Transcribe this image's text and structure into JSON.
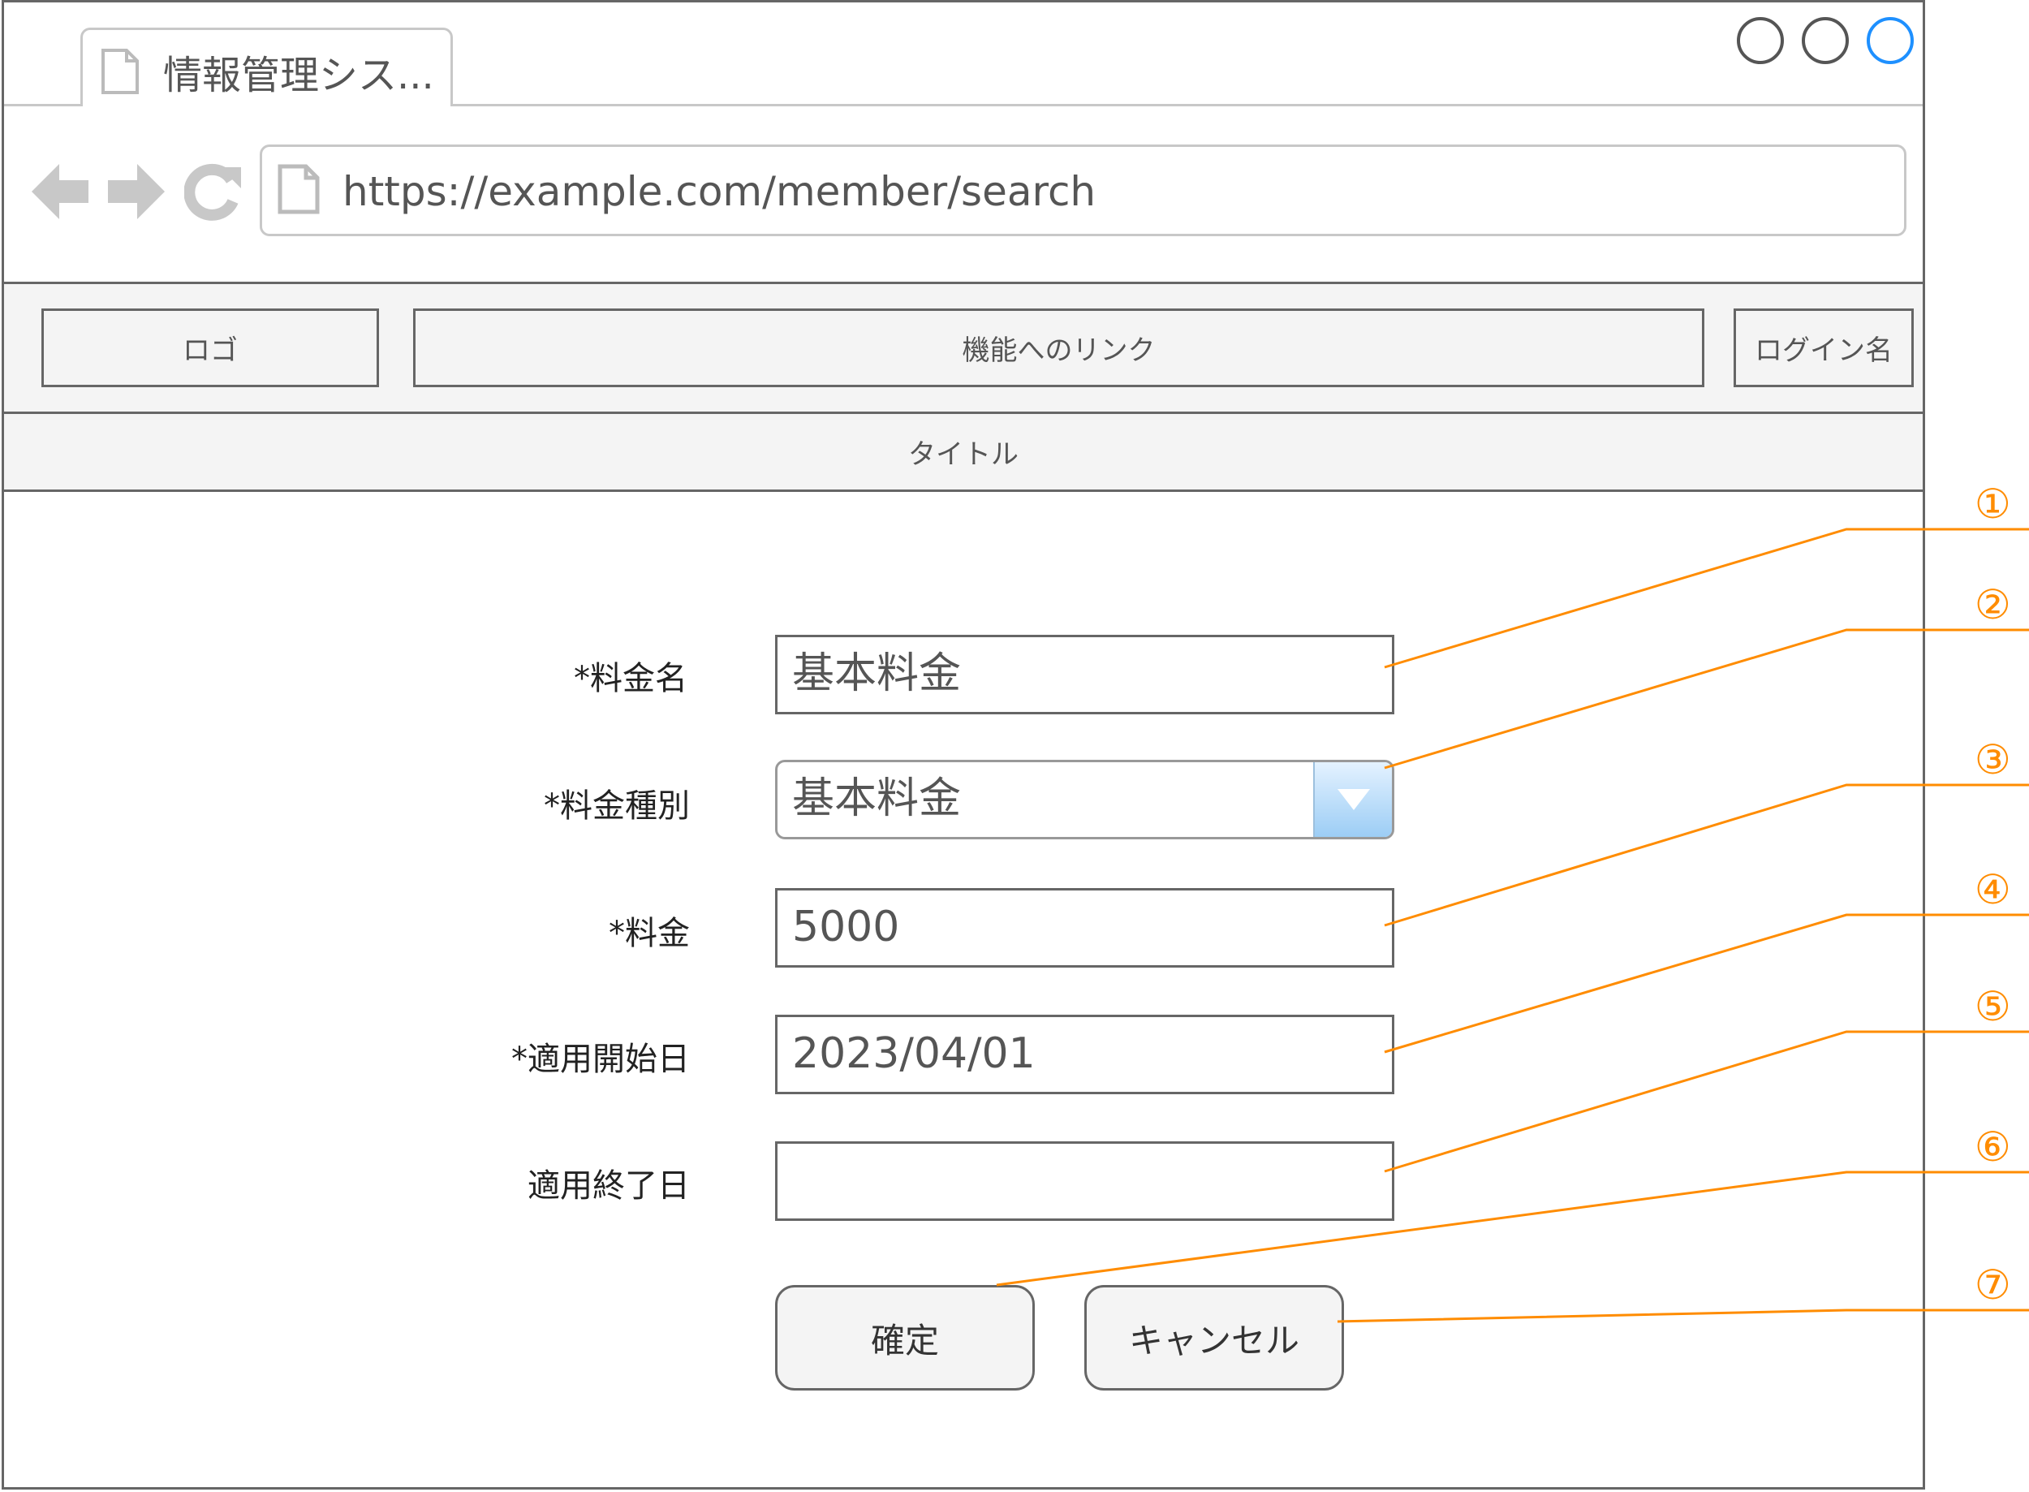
{
  "browser": {
    "tab_title": "情報管理シス...",
    "url": "https://example.com/member/search"
  },
  "header": {
    "logo": "ロゴ",
    "nav_links": "機能へのリンク",
    "login_name": "ログイン名",
    "title": "タイトル"
  },
  "form": {
    "fee_name_label": "*料金名",
    "fee_name_value": "基本料金",
    "fee_type_label": "*料金種別",
    "fee_type_value": "基本料金",
    "fee_label": "*料金",
    "fee_value": "5000",
    "start_date_label": "*適用開始日",
    "start_date_value": "2023/04/01",
    "end_date_label": "適用終了日",
    "end_date_value": "",
    "confirm_label": "確定",
    "cancel_label": "キャンセル"
  },
  "callouts": [
    "①",
    "②",
    "③",
    "④",
    "⑤",
    "⑥",
    "⑦"
  ],
  "colors": {
    "callout": "#ff8c00",
    "frame": "#666666",
    "header_bg": "#f4f4f4",
    "window_control_active": "#1e90ff"
  }
}
